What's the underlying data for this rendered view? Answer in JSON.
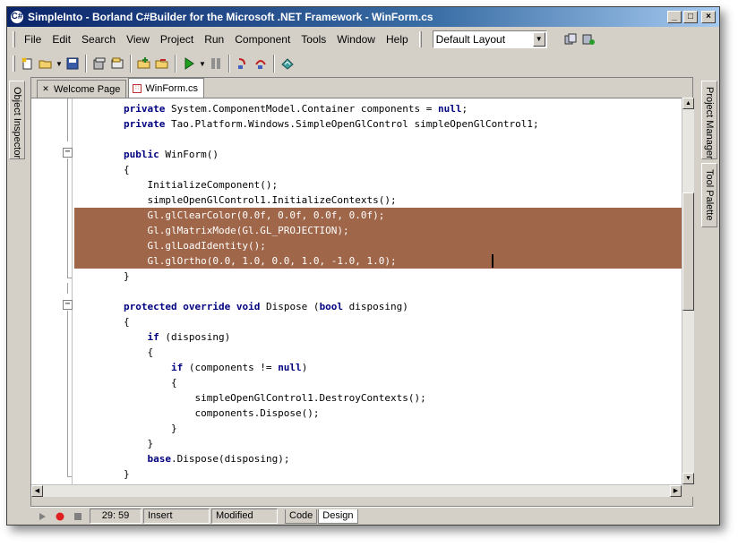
{
  "window": {
    "title": "SimpleInto - Borland C#Builder for the Microsoft .NET Framework - WinForm.cs",
    "app_icon": "C#",
    "controls": {
      "minimize": "_",
      "maximize": "□",
      "close": "×"
    }
  },
  "menu": {
    "items": [
      "File",
      "Edit",
      "Search",
      "View",
      "Project",
      "Run",
      "Component",
      "Tools",
      "Window",
      "Help"
    ],
    "layout_select": "Default Layout"
  },
  "toolbar": {
    "icons": [
      "new-items-icon",
      "open-icon",
      "save-icon",
      "save-all-icon",
      "open-project-icon",
      "add-file-icon",
      "remove-file-icon",
      "run-icon",
      "pause-icon",
      "step-over-icon",
      "trace-into-icon",
      "help-icon"
    ]
  },
  "left_panel": {
    "object_inspector": "Object Inspector"
  },
  "right_panel": {
    "project_manager": "Project Manager",
    "tool_palette": "Tool Palette"
  },
  "tabs": [
    {
      "label": "Welcome Page",
      "icon": "close-x-icon"
    },
    {
      "label": "WinForm.cs",
      "icon": "form-file-icon",
      "active": true
    }
  ],
  "code": [
    [
      {
        "t": "        "
      },
      {
        "k": "private"
      },
      {
        "t": " System.ComponentModel.Container components = "
      },
      {
        "k": "null"
      },
      {
        "t": ";"
      }
    ],
    [
      {
        "t": "        "
      },
      {
        "k": "private"
      },
      {
        "t": " Tao.Platform.Windows.SimpleOpenGlControl simpleOpenGlControl1;"
      }
    ],
    [],
    [
      {
        "t": "        "
      },
      {
        "k": "public"
      },
      {
        "t": " WinForm()"
      }
    ],
    [
      {
        "t": "        {"
      }
    ],
    [
      {
        "t": "            InitializeComponent();"
      }
    ],
    [
      {
        "t": "            simpleOpenGlControl1.InitializeContexts();"
      }
    ],
    [
      {
        "t": "            Gl.glClearColor(0.0f, 0.0f, 0.0f, 0.0f);"
      }
    ],
    [
      {
        "t": "            Gl.glMatrixMode(Gl.GL_PROJECTION);"
      }
    ],
    [
      {
        "t": "            Gl.glLoadIdentity();"
      }
    ],
    [
      {
        "t": "            Gl.glOrtho(0.0, 1.0, 0.0, 1.0, -1.0, 1.0);"
      }
    ],
    [
      {
        "t": "        }"
      }
    ],
    [],
    [
      {
        "t": "        "
      },
      {
        "k": "protected"
      },
      {
        "t": " "
      },
      {
        "k": "override"
      },
      {
        "t": " "
      },
      {
        "k": "void"
      },
      {
        "t": " Dispose ("
      },
      {
        "k": "bool"
      },
      {
        "t": " disposing)"
      }
    ],
    [
      {
        "t": "        {"
      }
    ],
    [
      {
        "t": "            "
      },
      {
        "k": "if"
      },
      {
        "t": " (disposing)"
      }
    ],
    [
      {
        "t": "            {"
      }
    ],
    [
      {
        "t": "                "
      },
      {
        "k": "if"
      },
      {
        "t": " (components != "
      },
      {
        "k": "null"
      },
      {
        "t": ")"
      }
    ],
    [
      {
        "t": "                {"
      }
    ],
    [
      {
        "t": "                    simpleOpenGlControl1.DestroyContexts();"
      }
    ],
    [
      {
        "t": "                    components.Dispose();"
      }
    ],
    [
      {
        "t": "                }"
      }
    ],
    [
      {
        "t": "            }"
      }
    ],
    [
      {
        "t": "            "
      },
      {
        "k": "base"
      },
      {
        "t": ".Dispose(disposing);"
      }
    ],
    [
      {
        "t": "        }"
      }
    ]
  ],
  "selected_lines": [
    7,
    8,
    9,
    10
  ],
  "status": {
    "position": "29: 59",
    "mode": "Insert",
    "state": "Modified",
    "view_tabs": [
      "Code",
      "Design"
    ],
    "active_view": "Design"
  },
  "colors": {
    "selection": "#a0664a",
    "keyword": "#000080",
    "chrome": "#d4d0c8"
  }
}
